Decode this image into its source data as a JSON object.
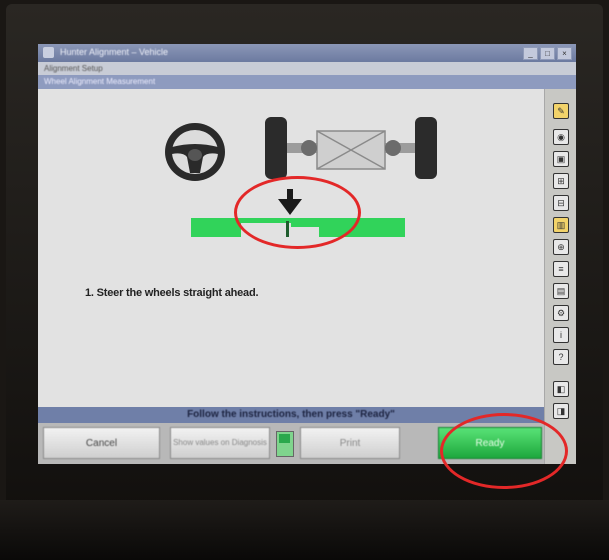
{
  "window": {
    "title": "Hunter Alignment – Vehicle",
    "menu": "Alignment Setup",
    "nav": "Wheel Alignment Measurement"
  },
  "content": {
    "instruction": "1. Steer the wheels straight ahead."
  },
  "status": {
    "message": "Follow the instructions, then press \"Ready\""
  },
  "buttons": {
    "cancel": "Cancel",
    "sheet": "Show values on Diagnosis",
    "print": "Print",
    "ready": "Ready"
  },
  "colors": {
    "meter_green": "#31d35a",
    "highlight_red": "#e32828",
    "ready_green": "#1ea83d"
  },
  "icons": [
    "pencil-icon",
    "gauge-icon",
    "vehicle-icon",
    "sensor-icon",
    "measure-icon",
    "settings-icon"
  ]
}
